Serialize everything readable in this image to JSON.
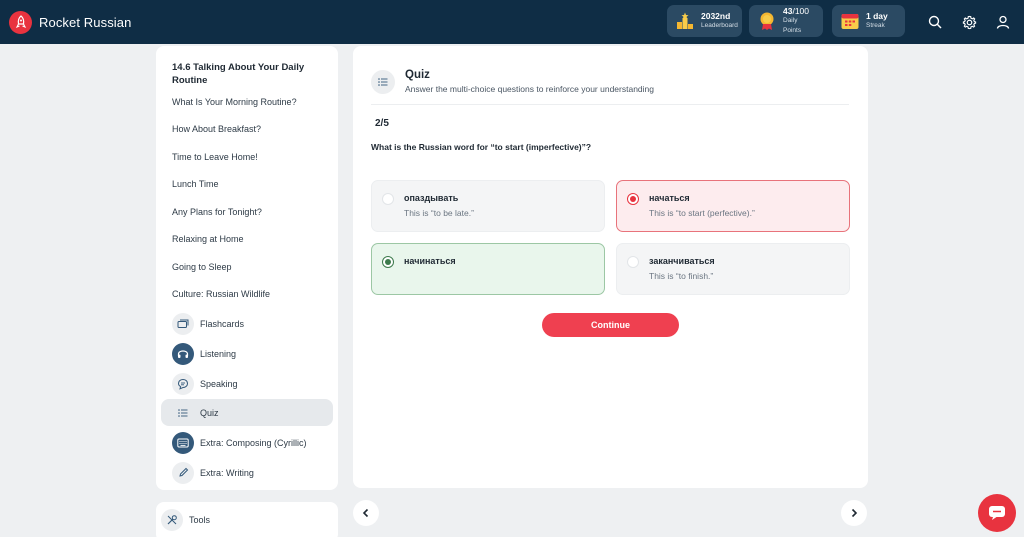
{
  "brand": {
    "name": "Rocket Russian"
  },
  "stats": {
    "leaderboard": {
      "value": "2032nd",
      "label": "Leaderboard"
    },
    "points": {
      "value": "43",
      "total": "/100",
      "label": "Daily Points"
    },
    "streak": {
      "value": "1 day",
      "label": "Streak"
    }
  },
  "sidebar": {
    "lesson_title": "14.6 Talking About Your Daily Routine",
    "lessons": [
      "What Is Your Morning Routine?",
      "How About Breakfast?",
      "Time to Leave Home!",
      "Lunch Time",
      "Any Plans for Tonight?",
      "Relaxing at Home",
      "Going to Sleep",
      "Culture: Russian Wildlife"
    ],
    "activities": [
      {
        "label": "Flashcards",
        "icon": "flashcards-icon"
      },
      {
        "label": "Listening",
        "icon": "headphones-icon"
      },
      {
        "label": "Speaking",
        "icon": "speech-bubble-icon"
      },
      {
        "label": "Quiz",
        "icon": "list-icon"
      },
      {
        "label": "Extra: Composing (Cyrillic)",
        "icon": "keyboard-icon"
      },
      {
        "label": "Extra: Writing",
        "icon": "pencil-icon"
      }
    ],
    "tools_label": "Tools"
  },
  "quiz": {
    "title": "Quiz",
    "subtitle": "Answer the multi-choice questions to reinforce your understanding",
    "progress": "2/5",
    "question": "What is the Russian word for “to start (imperfective)”?",
    "options": [
      {
        "word": "опаздывать",
        "note": "This is “to be late.”",
        "state": "neutral"
      },
      {
        "word": "начаться",
        "note": "This is “to start (perfective).”",
        "state": "wrong"
      },
      {
        "word": "начинаться",
        "note": "",
        "state": "correct"
      },
      {
        "word": "заканчиваться",
        "note": "This is “to finish.”",
        "state": "neutral"
      }
    ],
    "continue_label": "Continue"
  },
  "colors": {
    "topbar": "#0f2d45",
    "accent": "#e8333f",
    "correct": "#3d7a4c"
  }
}
